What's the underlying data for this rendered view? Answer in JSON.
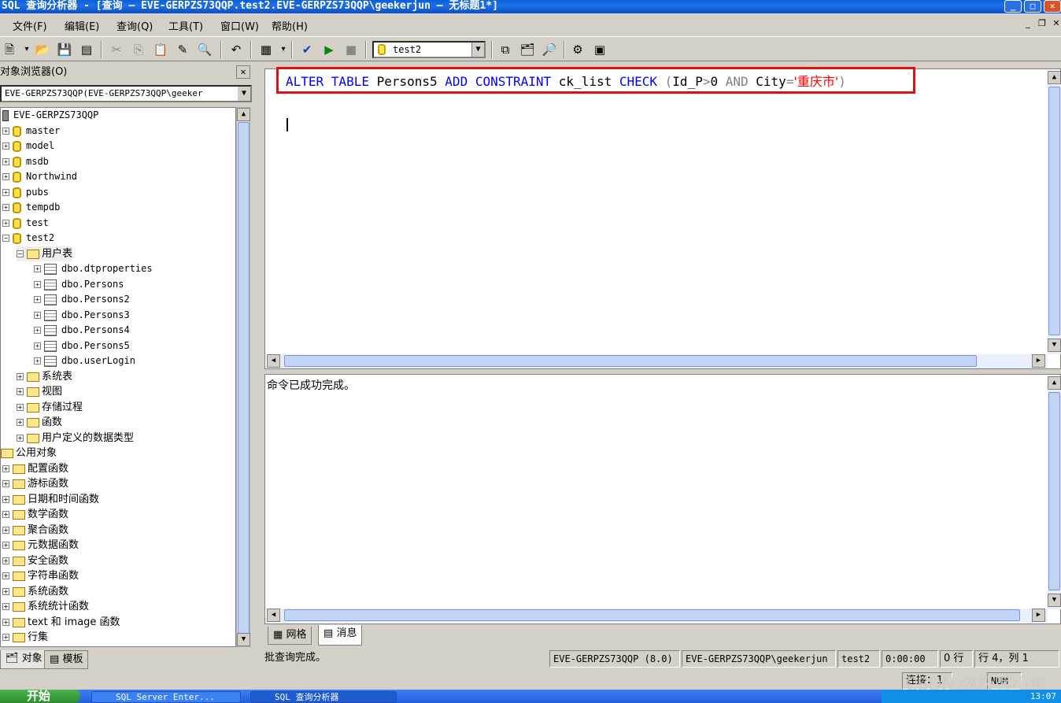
{
  "window": {
    "title": "SQL 查询分析器 - [查询 — EVE-GERPZS73QQP.test2.EVE-GERPZS73QQP\\geekerjun — 无标题1*]"
  },
  "menu": [
    "文件(F)",
    "编辑(E)",
    "查询(Q)",
    "工具(T)",
    "窗口(W)",
    "帮助(H)"
  ],
  "toolbar": {
    "database": "test2"
  },
  "object_browser": {
    "title": "对象浏览器(O)",
    "server_combo": "EVE-GERPZS73QQP(EVE-GERPZS73QQP\\geeker",
    "server": "EVE-GERPZS73QQP",
    "databases": [
      "master",
      "model",
      "msdb",
      "Northwind",
      "pubs",
      "tempdb",
      "test",
      "test2"
    ],
    "user_tables_label": "用户表",
    "tables": [
      "dbo.dtproperties",
      "dbo.Persons",
      "dbo.Persons2",
      "dbo.Persons3",
      "dbo.Persons4",
      "dbo.Persons5",
      "dbo.userLogin"
    ],
    "db_folders": [
      "系统表",
      "视图",
      "存储过程",
      "函数",
      "用户定义的数据类型"
    ],
    "public_objects": "公用对象",
    "public_folders": [
      "配置函数",
      "游标函数",
      "日期和时间函数",
      "数学函数",
      "聚合函数",
      "元数据函数",
      "安全函数",
      "字符串函数",
      "系统函数",
      "系统统计函数",
      "text 和 image 函数",
      "行集"
    ],
    "tab_objects": "对象",
    "tab_templates": "模板"
  },
  "editor": {
    "sql": {
      "kw1": "ALTER TABLE",
      "t1": " Persons5 ",
      "kw2": "ADD CONSTRAINT",
      "t2": " ck_list ",
      "kw3": "CHECK",
      "g1": " (",
      "t3": "Id_P",
      "g2": ">",
      "t4": "0 ",
      "g3": "AND",
      "t5": " City",
      "g4": "=",
      "str": "'重庆市'",
      "g5": ")"
    }
  },
  "results": {
    "message": "命令已成功完成。",
    "tab_grid": "网格",
    "tab_messages": "消息"
  },
  "status": {
    "left": "批查询完成。",
    "server": "EVE-GERPZS73QQP (8.0)",
    "user": "EVE-GERPZS73QQP\\geekerjun",
    "db": "test2",
    "time": "0:00:00",
    "rows": "0 行",
    "position": "行 4，列 1",
    "connections": "连接：1",
    "mode": "NUM"
  },
  "taskbar": {
    "start": "开始",
    "task1": "SQL Server Enter...",
    "task2": "SQL 查询分析器",
    "clock": "13:07"
  },
  "watermark": "CSDN @极客小俊"
}
